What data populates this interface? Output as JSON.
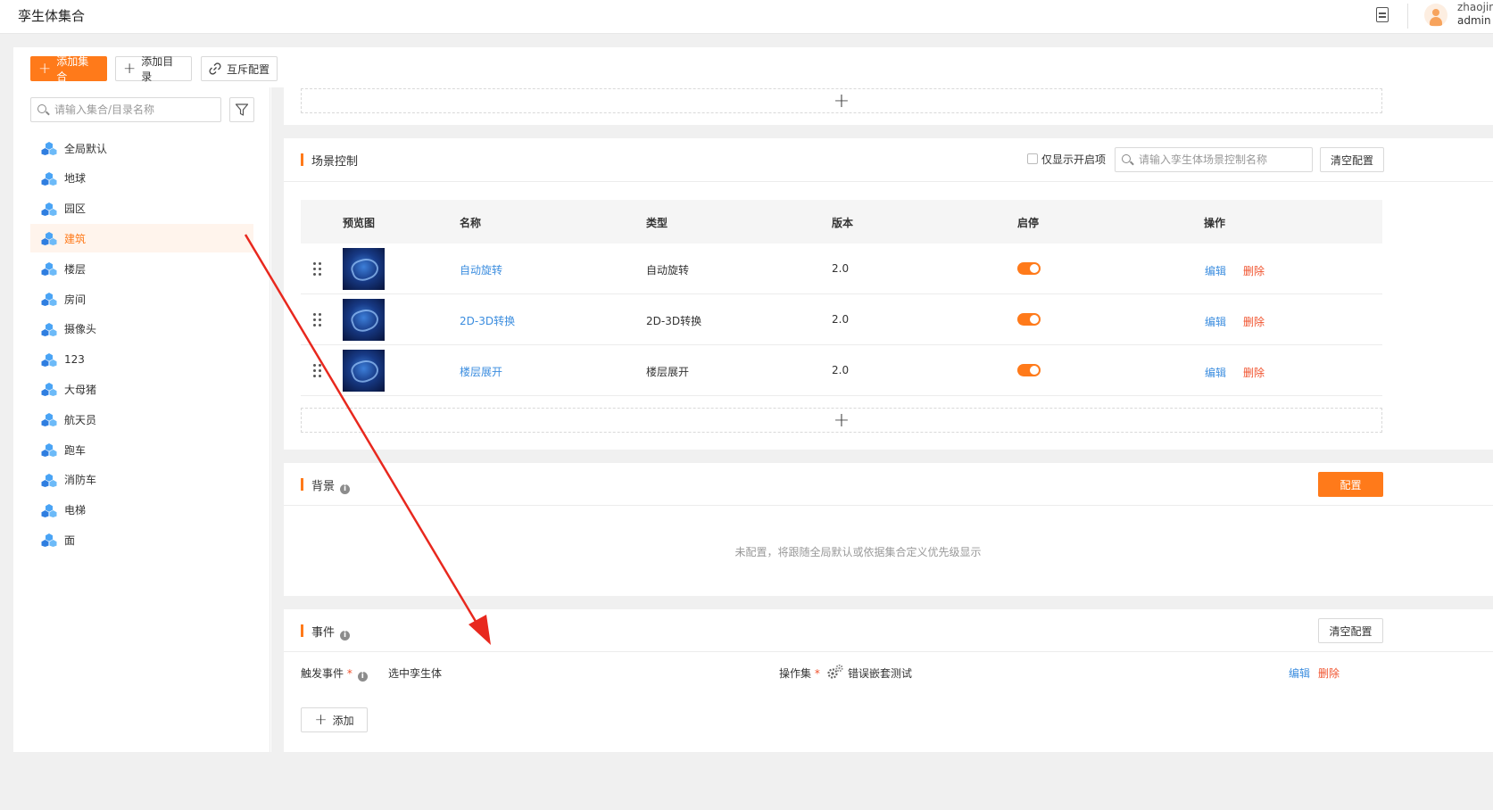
{
  "header": {
    "title": "孪生体集合",
    "user_name": "zhaojin",
    "user_role": "admin"
  },
  "toolbar": {
    "add_collection": "添加集合",
    "add_directory": "添加目录",
    "mutex_config": "互斥配置"
  },
  "sidebar": {
    "search_placeholder": "请输入集合/目录名称",
    "items": [
      {
        "label": "全局默认"
      },
      {
        "label": "地球"
      },
      {
        "label": "园区"
      },
      {
        "label": "建筑",
        "active": true
      },
      {
        "label": "楼层"
      },
      {
        "label": "房间"
      },
      {
        "label": "摄像头"
      },
      {
        "label": "123"
      },
      {
        "label": "大母猪"
      },
      {
        "label": "航天员"
      },
      {
        "label": "跑车"
      },
      {
        "label": "消防车"
      },
      {
        "label": "电梯"
      },
      {
        "label": "面"
      }
    ]
  },
  "scene_control": {
    "title": "场景控制",
    "only_enabled_label": "仅显示开启项",
    "search_placeholder": "请输入孪生体场景控制名称",
    "clear_button": "清空配置",
    "columns": [
      "预览图",
      "名称",
      "类型",
      "版本",
      "启停",
      "操作"
    ],
    "rows": [
      {
        "name": "自动旋转",
        "type": "自动旋转",
        "version": "2.0",
        "enabled": true,
        "edit": "编辑",
        "delete": "删除"
      },
      {
        "name": "2D-3D转换",
        "type": "2D-3D转换",
        "version": "2.0",
        "enabled": true,
        "edit": "编辑",
        "delete": "删除"
      },
      {
        "name": "楼层展开",
        "type": "楼层展开",
        "version": "2.0",
        "enabled": true,
        "edit": "编辑",
        "delete": "删除"
      }
    ]
  },
  "background": {
    "title": "背景",
    "config_button": "配置",
    "empty_text": "未配置，将跟随全局默认或依据集合定义优先级显示"
  },
  "events": {
    "title": "事件",
    "clear_button": "清空配置",
    "trigger_label": "触发事件",
    "trigger_value": "选中孪生体",
    "action_set_label": "操作集",
    "action_set_value": "错误嵌套测试",
    "edit": "编辑",
    "delete": "删除",
    "add_button": "添加"
  },
  "colors": {
    "accent": "#ff7a1a",
    "link": "#3b8ddf",
    "danger": "#f0522d",
    "annotation_arrow": "#e8281e"
  }
}
